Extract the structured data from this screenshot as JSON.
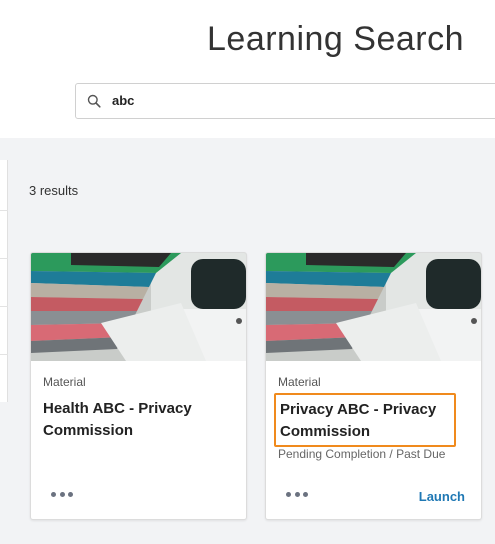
{
  "header": {
    "title": "Learning Search",
    "search": {
      "value": "abc",
      "icon": "search-icon"
    }
  },
  "results": {
    "count_label": "3 results",
    "cards": [
      {
        "type": "Material",
        "title": "Health ABC - Privacy Commission",
        "status": "",
        "more_icon": "more-icon",
        "action": ""
      },
      {
        "type": "Material",
        "title": "Privacy ABC - Privacy Commission",
        "status": "Pending Completion / Past Due",
        "more_icon": "more-icon",
        "action": "Launch"
      }
    ]
  },
  "colors": {
    "highlight_border": "#f08a1d",
    "link": "#1f78b4",
    "content_bg": "#f2f3f5"
  }
}
